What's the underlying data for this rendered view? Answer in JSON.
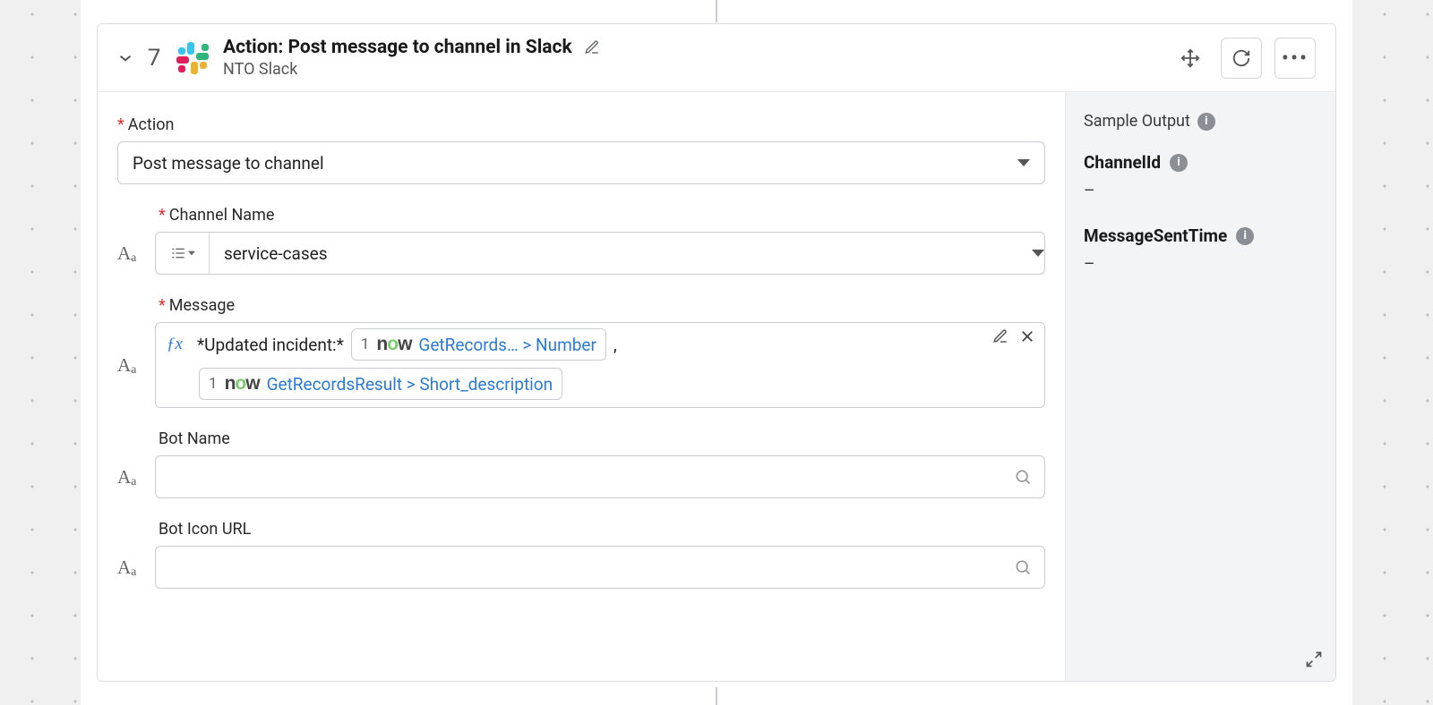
{
  "header": {
    "step_number": "7",
    "title": "Action: Post message to channel in Slack",
    "subtitle": "NTO Slack"
  },
  "form": {
    "action": {
      "label": "Action",
      "value": "Post message to channel"
    },
    "channel_name": {
      "label": "Channel Name",
      "value": "service-cases"
    },
    "message": {
      "label": "Message",
      "prefix_text": "*Updated incident:*",
      "pill1": {
        "step": "1",
        "text": "GetRecords…  > Number"
      },
      "sep": ",",
      "pill2": {
        "step": "1",
        "text": "GetRecordsResult > Short_description"
      }
    },
    "bot_name": {
      "label": "Bot Name"
    },
    "bot_icon_url": {
      "label": "Bot Icon URL"
    }
  },
  "output": {
    "heading": "Sample Output",
    "channel_id": {
      "label": "ChannelId",
      "value": "–"
    },
    "message_sent_time": {
      "label": "MessageSentTime",
      "value": "–"
    }
  }
}
